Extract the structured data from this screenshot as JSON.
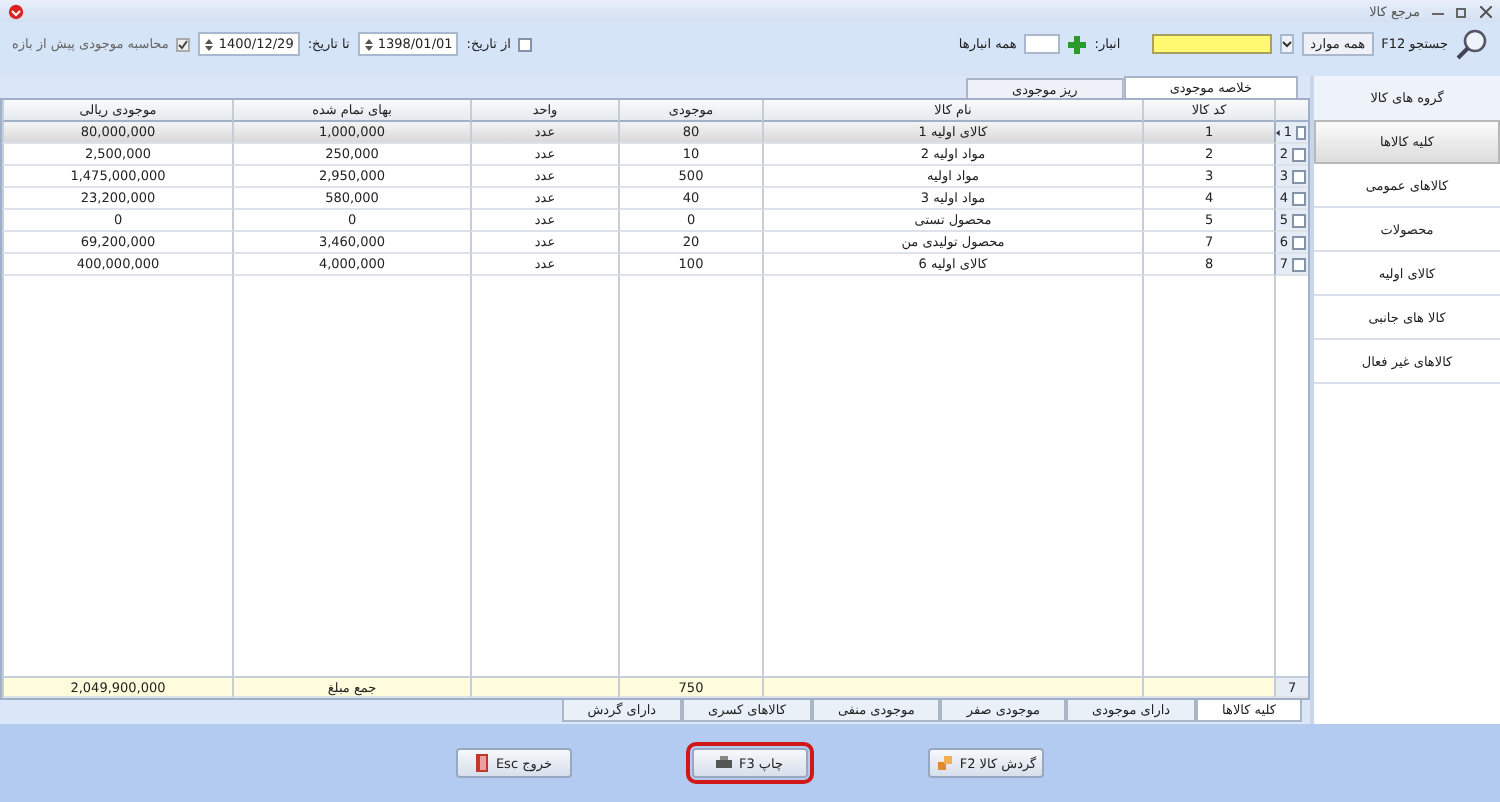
{
  "window": {
    "title": "مرجع کالا"
  },
  "toolbar": {
    "search_label": "جستجو F12",
    "scope": "همه موارد",
    "warehouse_label": "انبار:",
    "warehouse_scope": "همه انبارها",
    "from_date": {
      "label": "از تاریخ:",
      "checked": false,
      "value": "1398/01/01"
    },
    "to_date": {
      "label": "تا تاریخ:",
      "value": "1400/12/29"
    },
    "calc_before": {
      "label": "محاسبه موجودی پیش از بازه",
      "checked": true
    }
  },
  "tabs": [
    {
      "label": "خلاصه موجودی",
      "selected": true
    },
    {
      "label": "ریز موجودی",
      "selected": false
    }
  ],
  "sidebar": {
    "title": "گروه های کالا",
    "items": [
      {
        "label": "کلیه کالاها",
        "selected": true
      },
      {
        "label": "کالاهای عمومی",
        "selected": false
      },
      {
        "label": "محصولات",
        "selected": false
      },
      {
        "label": "کالای اولیه",
        "selected": false
      },
      {
        "label": "کالا های جانبی",
        "selected": false
      },
      {
        "label": "کالاهای غیر فعال",
        "selected": false
      }
    ]
  },
  "table": {
    "columns": [
      "کد کالا",
      "نام کالا",
      "موجودی",
      "واحد",
      "بهای تمام شده",
      "موجودی ریالی"
    ],
    "rows": [
      {
        "number": "1",
        "checked": false,
        "selected": true,
        "cells": [
          "1",
          "کالای اولیه 1",
          "80",
          "عدد",
          "1,000,000",
          "80,000,000"
        ]
      },
      {
        "number": "2",
        "checked": false,
        "selected": false,
        "cells": [
          "2",
          "مواد اولیه 2",
          "10",
          "عدد",
          "250,000",
          "2,500,000"
        ]
      },
      {
        "number": "3",
        "checked": false,
        "selected": false,
        "cells": [
          "3",
          "مواد اولیه",
          "500",
          "عدد",
          "2,950,000",
          "1,475,000,000"
        ]
      },
      {
        "number": "4",
        "checked": false,
        "selected": false,
        "cells": [
          "4",
          "مواد اولیه 3",
          "40",
          "عدد",
          "580,000",
          "23,200,000"
        ]
      },
      {
        "number": "5",
        "checked": false,
        "selected": false,
        "cells": [
          "5",
          "محصول تستی",
          "0",
          "عدد",
          "0",
          "0"
        ]
      },
      {
        "number": "6",
        "checked": false,
        "selected": false,
        "cells": [
          "7",
          "محصول تولیدی من",
          "20",
          "عدد",
          "3,460,000",
          "69,200,000"
        ]
      },
      {
        "number": "7",
        "checked": false,
        "selected": false,
        "cells": [
          "8",
          "کالای اولیه 6",
          "100",
          "عدد",
          "4,000,000",
          "400,000,000"
        ]
      }
    ],
    "footer": {
      "count": "7",
      "quantity_total": "750",
      "amount_label": "جمع مبلغ",
      "amount_total": "2,049,900,000"
    }
  },
  "filter_tabs": [
    {
      "label": "کلیه کالاها",
      "selected": true
    },
    {
      "label": "دارای موجودی",
      "selected": false
    },
    {
      "label": "موجودی صفر",
      "selected": false
    },
    {
      "label": "موجودی منفی",
      "selected": false
    },
    {
      "label": "کالاهای کسری",
      "selected": false
    },
    {
      "label": "دارای گردش",
      "selected": false
    }
  ],
  "buttons": [
    {
      "kind": "flow",
      "label": "گردش کالا F2",
      "highlighted": false
    },
    {
      "kind": "print",
      "label": "چاپ F3",
      "highlighted": true
    },
    {
      "kind": "exit",
      "label": "خروج Esc",
      "highlighted": false
    }
  ]
}
